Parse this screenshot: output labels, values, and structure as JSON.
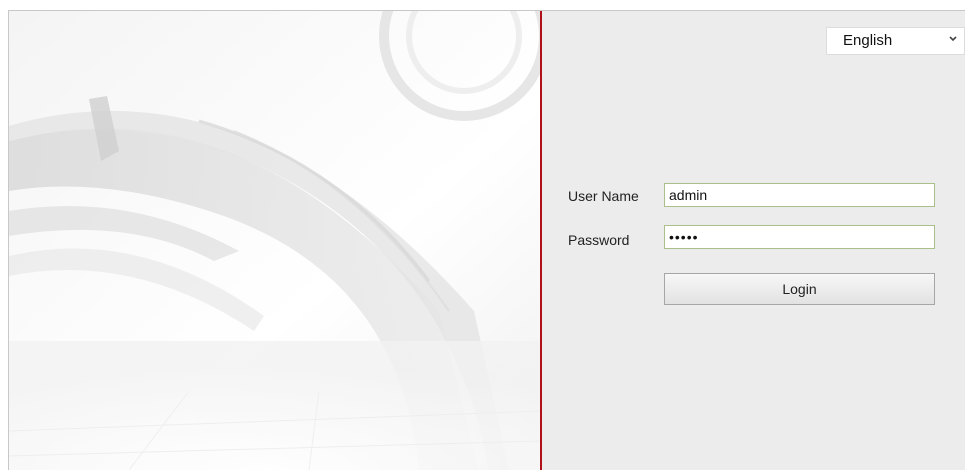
{
  "language_selector": {
    "selected": "English"
  },
  "login_form": {
    "username_label": "User Name",
    "username_value": "admin",
    "password_label": "Password",
    "password_value": "•••••",
    "login_label": "Login"
  },
  "colors": {
    "divider": "#b0101a",
    "panel_background": "#ececec",
    "input_border": "#a9c08a"
  },
  "icons": {
    "lang_dropdown": "chevron-down-icon",
    "decoration": "camera-lens-arc-graphic"
  }
}
